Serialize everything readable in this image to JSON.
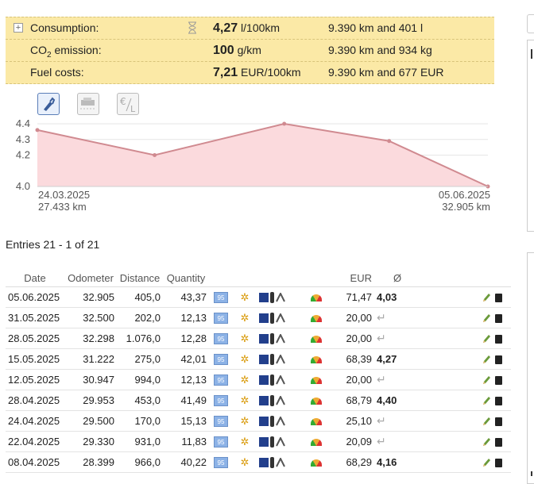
{
  "summary": [
    {
      "label": "Consumption:",
      "value": "4,27",
      "unit": "l/100km",
      "total": "9.390 km and 401 l"
    },
    {
      "label_main": "CO",
      "label_sub": "2",
      "label_rest": " emission:",
      "value": "100",
      "unit": "g/km",
      "total": "9.390 km and 934 kg"
    },
    {
      "label": "Fuel costs:",
      "value": "7,21",
      "unit": "EUR/100km",
      "total": "9.390 km and 677 EUR"
    }
  ],
  "chart_data": {
    "type": "area",
    "x": [
      "24.03.2025",
      "2025-04-12",
      "2025-05-03",
      "2025-05-20",
      "05.06.2025"
    ],
    "values": [
      4.36,
      4.2,
      4.4,
      4.29,
      4.0
    ],
    "ylim": [
      4.0,
      4.4
    ],
    "yticks": [
      "4.4",
      "4.3",
      "4.2",
      "4.0"
    ],
    "x_start_label": "24.03.2025",
    "x_start_km": "27.433 km",
    "x_end_label": "05.06.2025",
    "x_end_km": "32.905 km",
    "line_color": "#d08a90",
    "fill_color": "#fbdadd",
    "grid": true
  },
  "entries_label": "Entries 21 - 1 of 21",
  "table": {
    "headers": {
      "date": "Date",
      "odometer": "Odometer",
      "distance": "Distance",
      "quantity": "Quantity",
      "eur": "EUR",
      "avg": "Ø"
    },
    "fuel_badge": "95",
    "return_glyph": "↵",
    "rows": [
      {
        "date": "05.06.2025",
        "odometer": "32.905",
        "distance": "405,0",
        "quantity": "43,37",
        "eur": "71,47",
        "avg": "4,03"
      },
      {
        "date": "31.05.2025",
        "odometer": "32.500",
        "distance": "202,0",
        "quantity": "12,13",
        "eur": "20,00",
        "avg": ""
      },
      {
        "date": "28.05.2025",
        "odometer": "32.298",
        "distance": "1.076,0",
        "quantity": "12,28",
        "eur": "20,00",
        "avg": ""
      },
      {
        "date": "15.05.2025",
        "odometer": "31.222",
        "distance": "275,0",
        "quantity": "42,01",
        "eur": "68,39",
        "avg": "4,27"
      },
      {
        "date": "12.05.2025",
        "odometer": "30.947",
        "distance": "994,0",
        "quantity": "12,13",
        "eur": "20,00",
        "avg": ""
      },
      {
        "date": "28.04.2025",
        "odometer": "29.953",
        "distance": "453,0",
        "quantity": "41,49",
        "eur": "68,79",
        "avg": "4,40"
      },
      {
        "date": "24.04.2025",
        "odometer": "29.500",
        "distance": "170,0",
        "quantity": "15,13",
        "eur": "25,10",
        "avg": ""
      },
      {
        "date": "22.04.2025",
        "odometer": "29.330",
        "distance": "931,0",
        "quantity": "11,83",
        "eur": "20,09",
        "avg": ""
      },
      {
        "date": "08.04.2025",
        "odometer": "28.399",
        "distance": "966,0",
        "quantity": "40,22",
        "eur": "68,29",
        "avg": "4,16"
      }
    ]
  }
}
